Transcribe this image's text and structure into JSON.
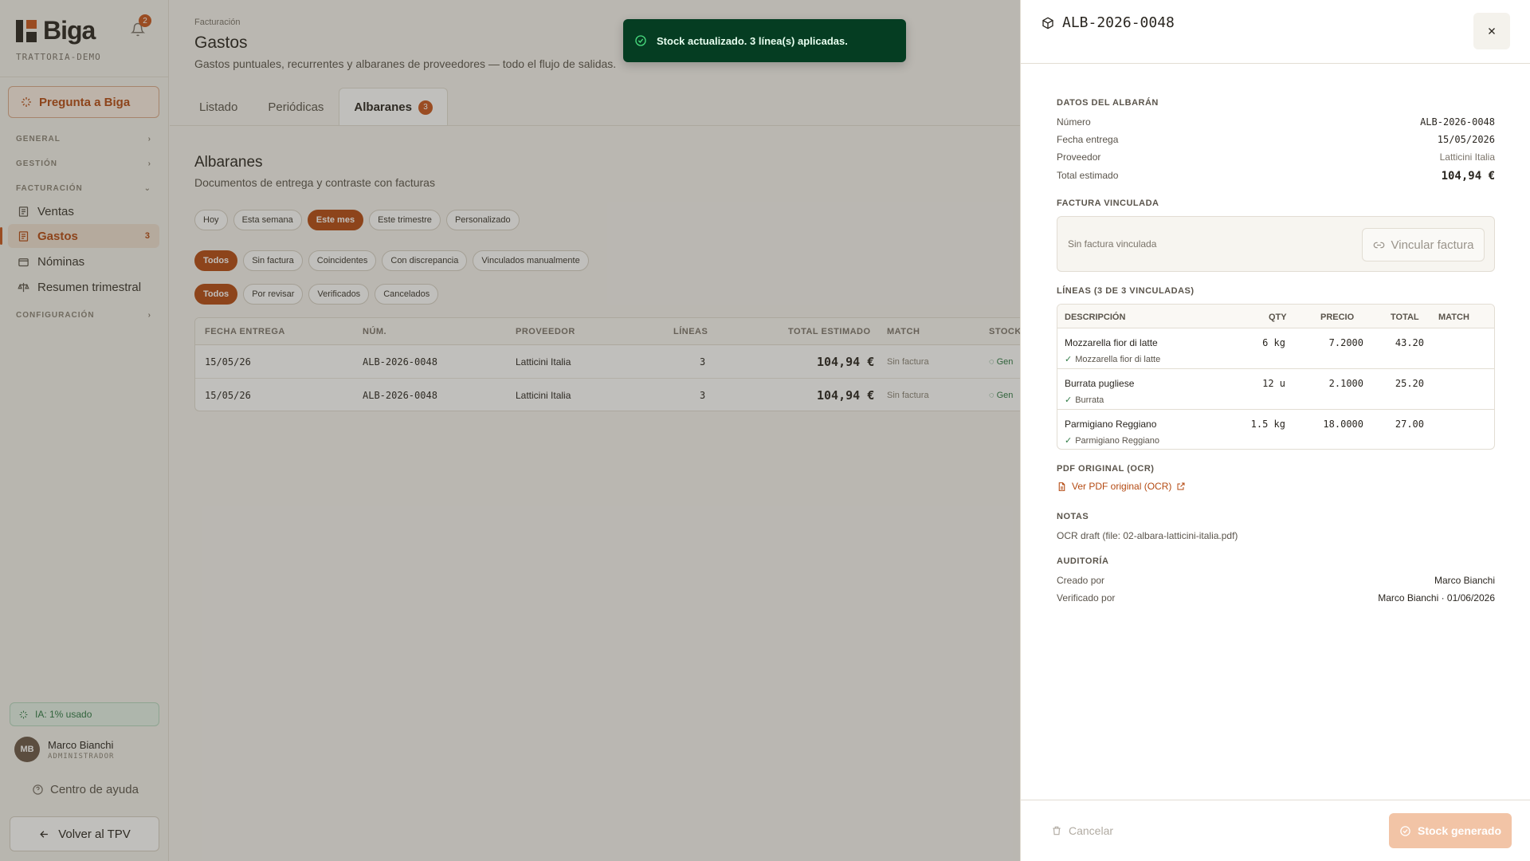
{
  "sidebar": {
    "brand": "Biga",
    "workspace": "TRATTORIA-DEMO",
    "notifications": "2",
    "ask_label": "Pregunta a Biga",
    "groups": {
      "general": "GENERAL",
      "gestion": "GESTIÓN",
      "facturacion": "FACTURACIÓN",
      "configuracion": "CONFIGURACIÓN"
    },
    "items": [
      {
        "label": "Ventas"
      },
      {
        "label": "Gastos",
        "count": "3"
      },
      {
        "label": "Nóminas"
      },
      {
        "label": "Resumen trimestral"
      }
    ],
    "ai_usage": "IA: 1% usado",
    "user": {
      "initials": "MB",
      "name": "Marco Bianchi",
      "role": "ADMINISTRADOR"
    },
    "help": "Centro de ayuda",
    "back": "Volver al TPV"
  },
  "header": {
    "breadcrumb": "Facturación",
    "title": "Gastos",
    "subtitle": "Gastos puntuales, recurrentes y albaranes de proveedores — todo el flujo de salidas."
  },
  "tabs": [
    {
      "label": "Listado"
    },
    {
      "label": "Periódicas"
    },
    {
      "label": "Albaranes",
      "badge": "3"
    }
  ],
  "section": {
    "title": "Albaranes",
    "subtitle": "Documentos de entrega y contraste con facturas"
  },
  "filters": {
    "period": [
      "Hoy",
      "Esta semana",
      "Este mes",
      "Este trimestre",
      "Personalizado"
    ],
    "match": [
      "Todos",
      "Sin factura",
      "Coincidentes",
      "Con discrepancia",
      "Vinculados manualmente"
    ],
    "status": [
      "Todos",
      "Por revisar",
      "Verificados",
      "Cancelados"
    ]
  },
  "table": {
    "headers": [
      "FECHA ENTREGA",
      "NÚM.",
      "PROVEEDOR",
      "LÍNEAS",
      "TOTAL ESTIMADO",
      "MATCH",
      "STOCK"
    ],
    "rows": [
      {
        "date": "15/05/26",
        "num": "ALB-2026-0048",
        "supplier": "Latticini Italia",
        "lines": "3",
        "total": "104,94 €",
        "match": "Sin factura",
        "stock": "Gen"
      },
      {
        "date": "15/05/26",
        "num": "ALB-2026-0048",
        "supplier": "Latticini Italia",
        "lines": "3",
        "total": "104,94 €",
        "match": "Sin factura",
        "stock": "Gen"
      }
    ]
  },
  "toast": {
    "message": "Stock actualizado. 3 línea(s) aplicadas."
  },
  "drawer": {
    "title": "ALB-2026-0048",
    "datos": {
      "heading": "DATOS DEL ALBARÁN",
      "numero_label": "Número",
      "numero": "ALB-2026-0048",
      "fecha_label": "Fecha entrega",
      "fecha": "15/05/2026",
      "proveedor_label": "Proveedor",
      "proveedor": "Latticini Italia",
      "total_label": "Total estimado",
      "total": "104,94 €"
    },
    "factura": {
      "heading": "FACTURA VINCULADA",
      "empty": "Sin factura vinculada",
      "link_label": "Vincular factura"
    },
    "lineas": {
      "heading": "LÍNEAS (3 DE 3 VINCULADAS)",
      "headers": {
        "desc": "DESCRIPCIÓN",
        "qty": "QTY",
        "precio": "PRECIO",
        "total": "TOTAL",
        "match": "MATCH"
      },
      "rows": [
        {
          "desc": "Mozzarella fior di latte",
          "qty": "6 kg",
          "precio": "7.2000",
          "total": "43.20",
          "match": "Mozzarella fior di latte"
        },
        {
          "desc": "Burrata pugliese",
          "qty": "12 u",
          "precio": "2.1000",
          "total": "25.20",
          "match": "Burrata"
        },
        {
          "desc": "Parmigiano Reggiano",
          "qty": "1.5 kg",
          "precio": "18.0000",
          "total": "27.00",
          "match": "Parmigiano Reggiano"
        }
      ]
    },
    "pdf": {
      "heading": "PDF ORIGINAL (OCR)",
      "link": "Ver PDF original (OCR)"
    },
    "notas": {
      "heading": "NOTAS",
      "text": "OCR draft (file: 02-albara-latticini-italia.pdf)"
    },
    "auditoria": {
      "heading": "AUDITORÍA",
      "creado_label": "Creado por",
      "creado": "Marco Bianchi",
      "verificado_label": "Verificado por",
      "verificado": "Marco Bianchi · 01/06/2026"
    },
    "footer": {
      "cancel": "Cancelar",
      "stock": "Stock generado"
    }
  },
  "colors": {
    "accent": "#c8561c",
    "success": "#2f7a45",
    "toast_bg": "#053d22"
  }
}
